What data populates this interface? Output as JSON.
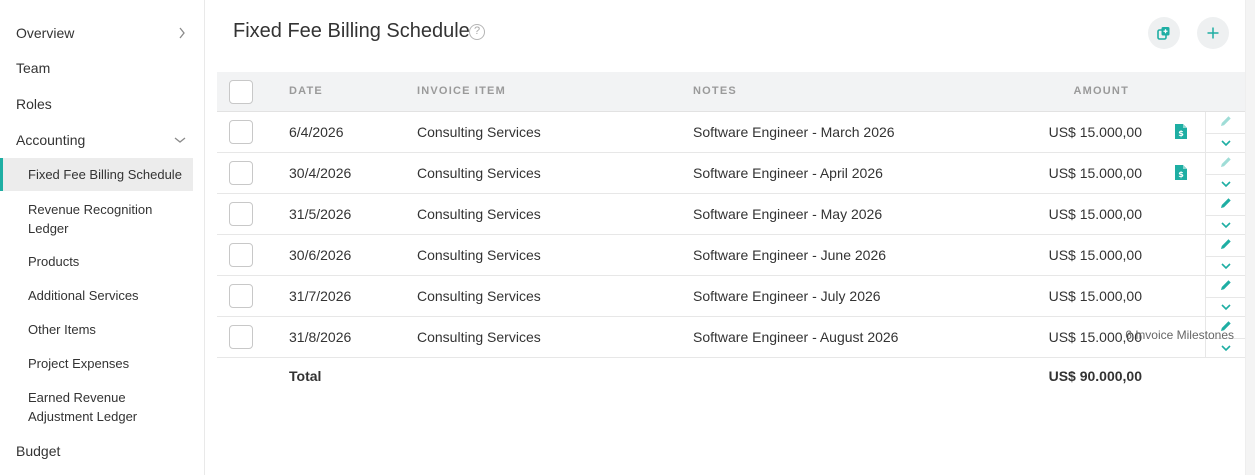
{
  "sidebar": {
    "overview": "Overview",
    "team": "Team",
    "roles": "Roles",
    "accounting": "Accounting",
    "budget": "Budget",
    "sub_items": [
      "Fixed Fee Billing Schedule",
      "Revenue Recognition Ledger",
      "Products",
      "Additional Services",
      "Other Items",
      "Project Expenses",
      "Earned Revenue Adjustment Ledger"
    ]
  },
  "header": {
    "title": "Fixed Fee Billing Schedule",
    "help": "?"
  },
  "table": {
    "columns": [
      "DATE",
      "INVOICE ITEM",
      "NOTES",
      "AMOUNT"
    ],
    "rows": [
      {
        "date": "6/4/2026",
        "item": "Consulting Services",
        "notes": "Software Engineer - March 2026",
        "amount": "US$ 15.000,00"
      },
      {
        "date": "30/4/2026",
        "item": "Consulting Services",
        "notes": "Software Engineer - April 2026",
        "amount": "US$ 15.000,00"
      },
      {
        "date": "31/5/2026",
        "item": "Consulting Services",
        "notes": "Software Engineer - May 2026",
        "amount": "US$ 15.000,00"
      },
      {
        "date": "30/6/2026",
        "item": "Consulting Services",
        "notes": "Software Engineer - June 2026",
        "amount": "US$ 15.000,00"
      },
      {
        "date": "31/7/2026",
        "item": "Consulting Services",
        "notes": "Software Engineer - July 2026",
        "amount": "US$ 15.000,00"
      },
      {
        "date": "31/8/2026",
        "item": "Consulting Services",
        "notes": "Software Engineer - August 2026",
        "amount": "US$ 15.000,00"
      }
    ],
    "total_label": "Total",
    "total_amount": "US$ 90.000,00",
    "footer": "6 Invoice Milestones"
  },
  "colors": {
    "accent": "#1eaea3",
    "accent_light": "#9fddd7",
    "header_bg": "#f2f3f4",
    "active_nav_bg": "#ececec"
  },
  "icons": {
    "overview_chevron": "chevron-right-icon",
    "accounting_chevron": "chevron-down-icon",
    "copy": "copy-icon",
    "add": "plus-icon",
    "invoice": "invoice-document-icon",
    "edit": "pencil-icon",
    "expand": "chevron-down-icon"
  }
}
